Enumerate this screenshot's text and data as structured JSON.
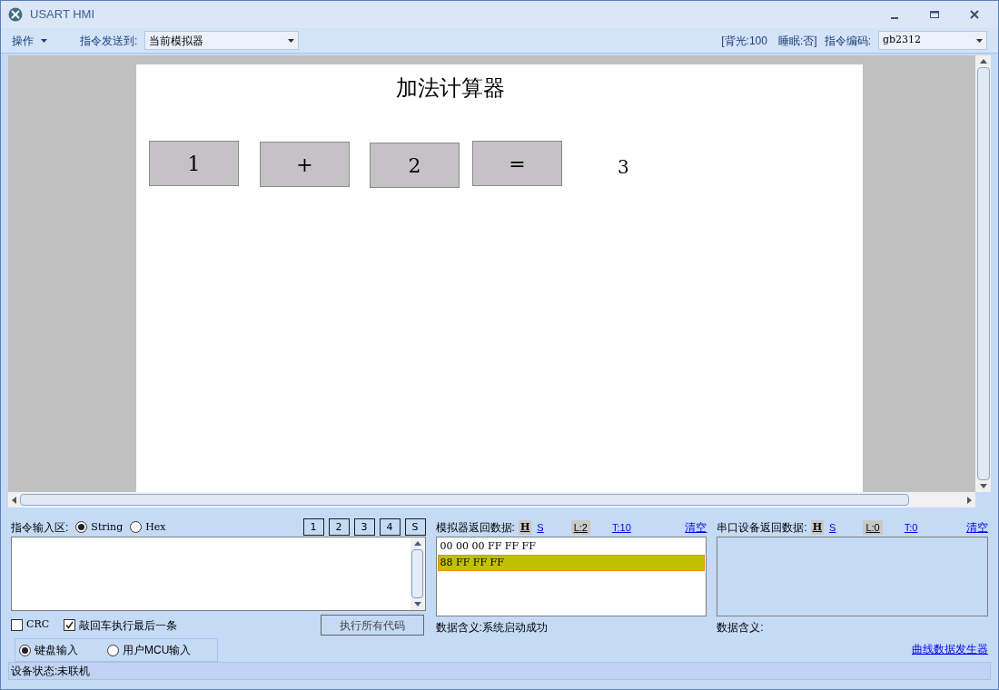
{
  "window": {
    "title": "USART HMI"
  },
  "toolbar": {
    "menu": "操作",
    "send_to_label": "指令发送到:",
    "send_to_value": "当前模拟器",
    "backlight": "[背光:100",
    "sleep": "睡眠:否]",
    "encoding_label": "指令编码:",
    "encoding_value": "gb2312"
  },
  "canvas": {
    "title": "加法计算器",
    "items": [
      {
        "kind": "button",
        "text": "1"
      },
      {
        "kind": "button",
        "text": "+"
      },
      {
        "kind": "button",
        "text": "2"
      },
      {
        "kind": "button",
        "text": "="
      },
      {
        "kind": "text",
        "text": "3"
      }
    ]
  },
  "command_input": {
    "label": "指令输入区:",
    "modes": [
      {
        "label": "String",
        "selected": true
      },
      {
        "label": "Hex",
        "selected": false
      }
    ],
    "slots": [
      "1",
      "2",
      "3",
      "4",
      "S"
    ],
    "options": [
      {
        "label": "CRC",
        "checked": false
      },
      {
        "label": "敲回车执行最后一条",
        "checked": true
      }
    ],
    "run_all": "执行所有代码",
    "sources": [
      {
        "label": "键盘输入",
        "selected": true
      },
      {
        "label": "用户MCU输入",
        "selected": false
      }
    ]
  },
  "simulator_return": {
    "label": "模拟器返回数据:",
    "formats": [
      {
        "label": "H",
        "selected": true
      },
      {
        "label": "S",
        "selected": false
      }
    ],
    "length": "L:2",
    "time": "T:10",
    "clear": "清空",
    "rows": [
      {
        "text": "00 00 00 FF FF FF",
        "selected": false
      },
      {
        "text": "88 FF FF FF",
        "selected": true
      }
    ],
    "meaning": "数据含义:系统启动成功"
  },
  "serial_return": {
    "label": "串口设备返回数据:",
    "formats": [
      {
        "label": "H",
        "selected": true
      },
      {
        "label": "S",
        "selected": false
      }
    ],
    "length": "L:0",
    "time": "T:0",
    "clear": "清空",
    "meaning": "数据含义:"
  },
  "curve_generator": "曲线数据发生器",
  "status_bar": "设备状态:未联机"
}
